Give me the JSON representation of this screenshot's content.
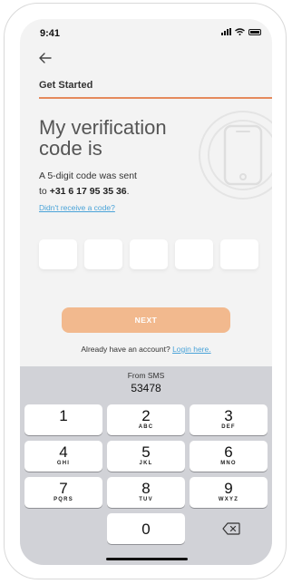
{
  "status_bar": {
    "time": "9:41"
  },
  "header": {
    "page_label": "Get Started"
  },
  "content": {
    "title": "My verification code is",
    "subtitle_prefix": "A 5-digit code was sent",
    "subtitle_to": "to",
    "phone_number": "+31 6 17 95 35 36",
    "period": ".",
    "resend_link": "Didn't receive a code?",
    "code_length": 5
  },
  "actions": {
    "next_label": "NEXT",
    "login_prompt": "Already have an account?",
    "login_link": "Login here."
  },
  "keyboard": {
    "suggestion_label": "From SMS",
    "suggestion_code": "53478",
    "keys": [
      {
        "num": "1",
        "letters": ""
      },
      {
        "num": "2",
        "letters": "ABC"
      },
      {
        "num": "3",
        "letters": "DEF"
      },
      {
        "num": "4",
        "letters": "GHI"
      },
      {
        "num": "5",
        "letters": "JKL"
      },
      {
        "num": "6",
        "letters": "MNO"
      },
      {
        "num": "7",
        "letters": "PQRS"
      },
      {
        "num": "8",
        "letters": "TUV"
      },
      {
        "num": "9",
        "letters": "WXYZ"
      },
      {
        "num": "0",
        "letters": ""
      }
    ]
  },
  "colors": {
    "accent": "#e58a5c",
    "button": "#f2b98e",
    "link": "#4aa3d8"
  }
}
